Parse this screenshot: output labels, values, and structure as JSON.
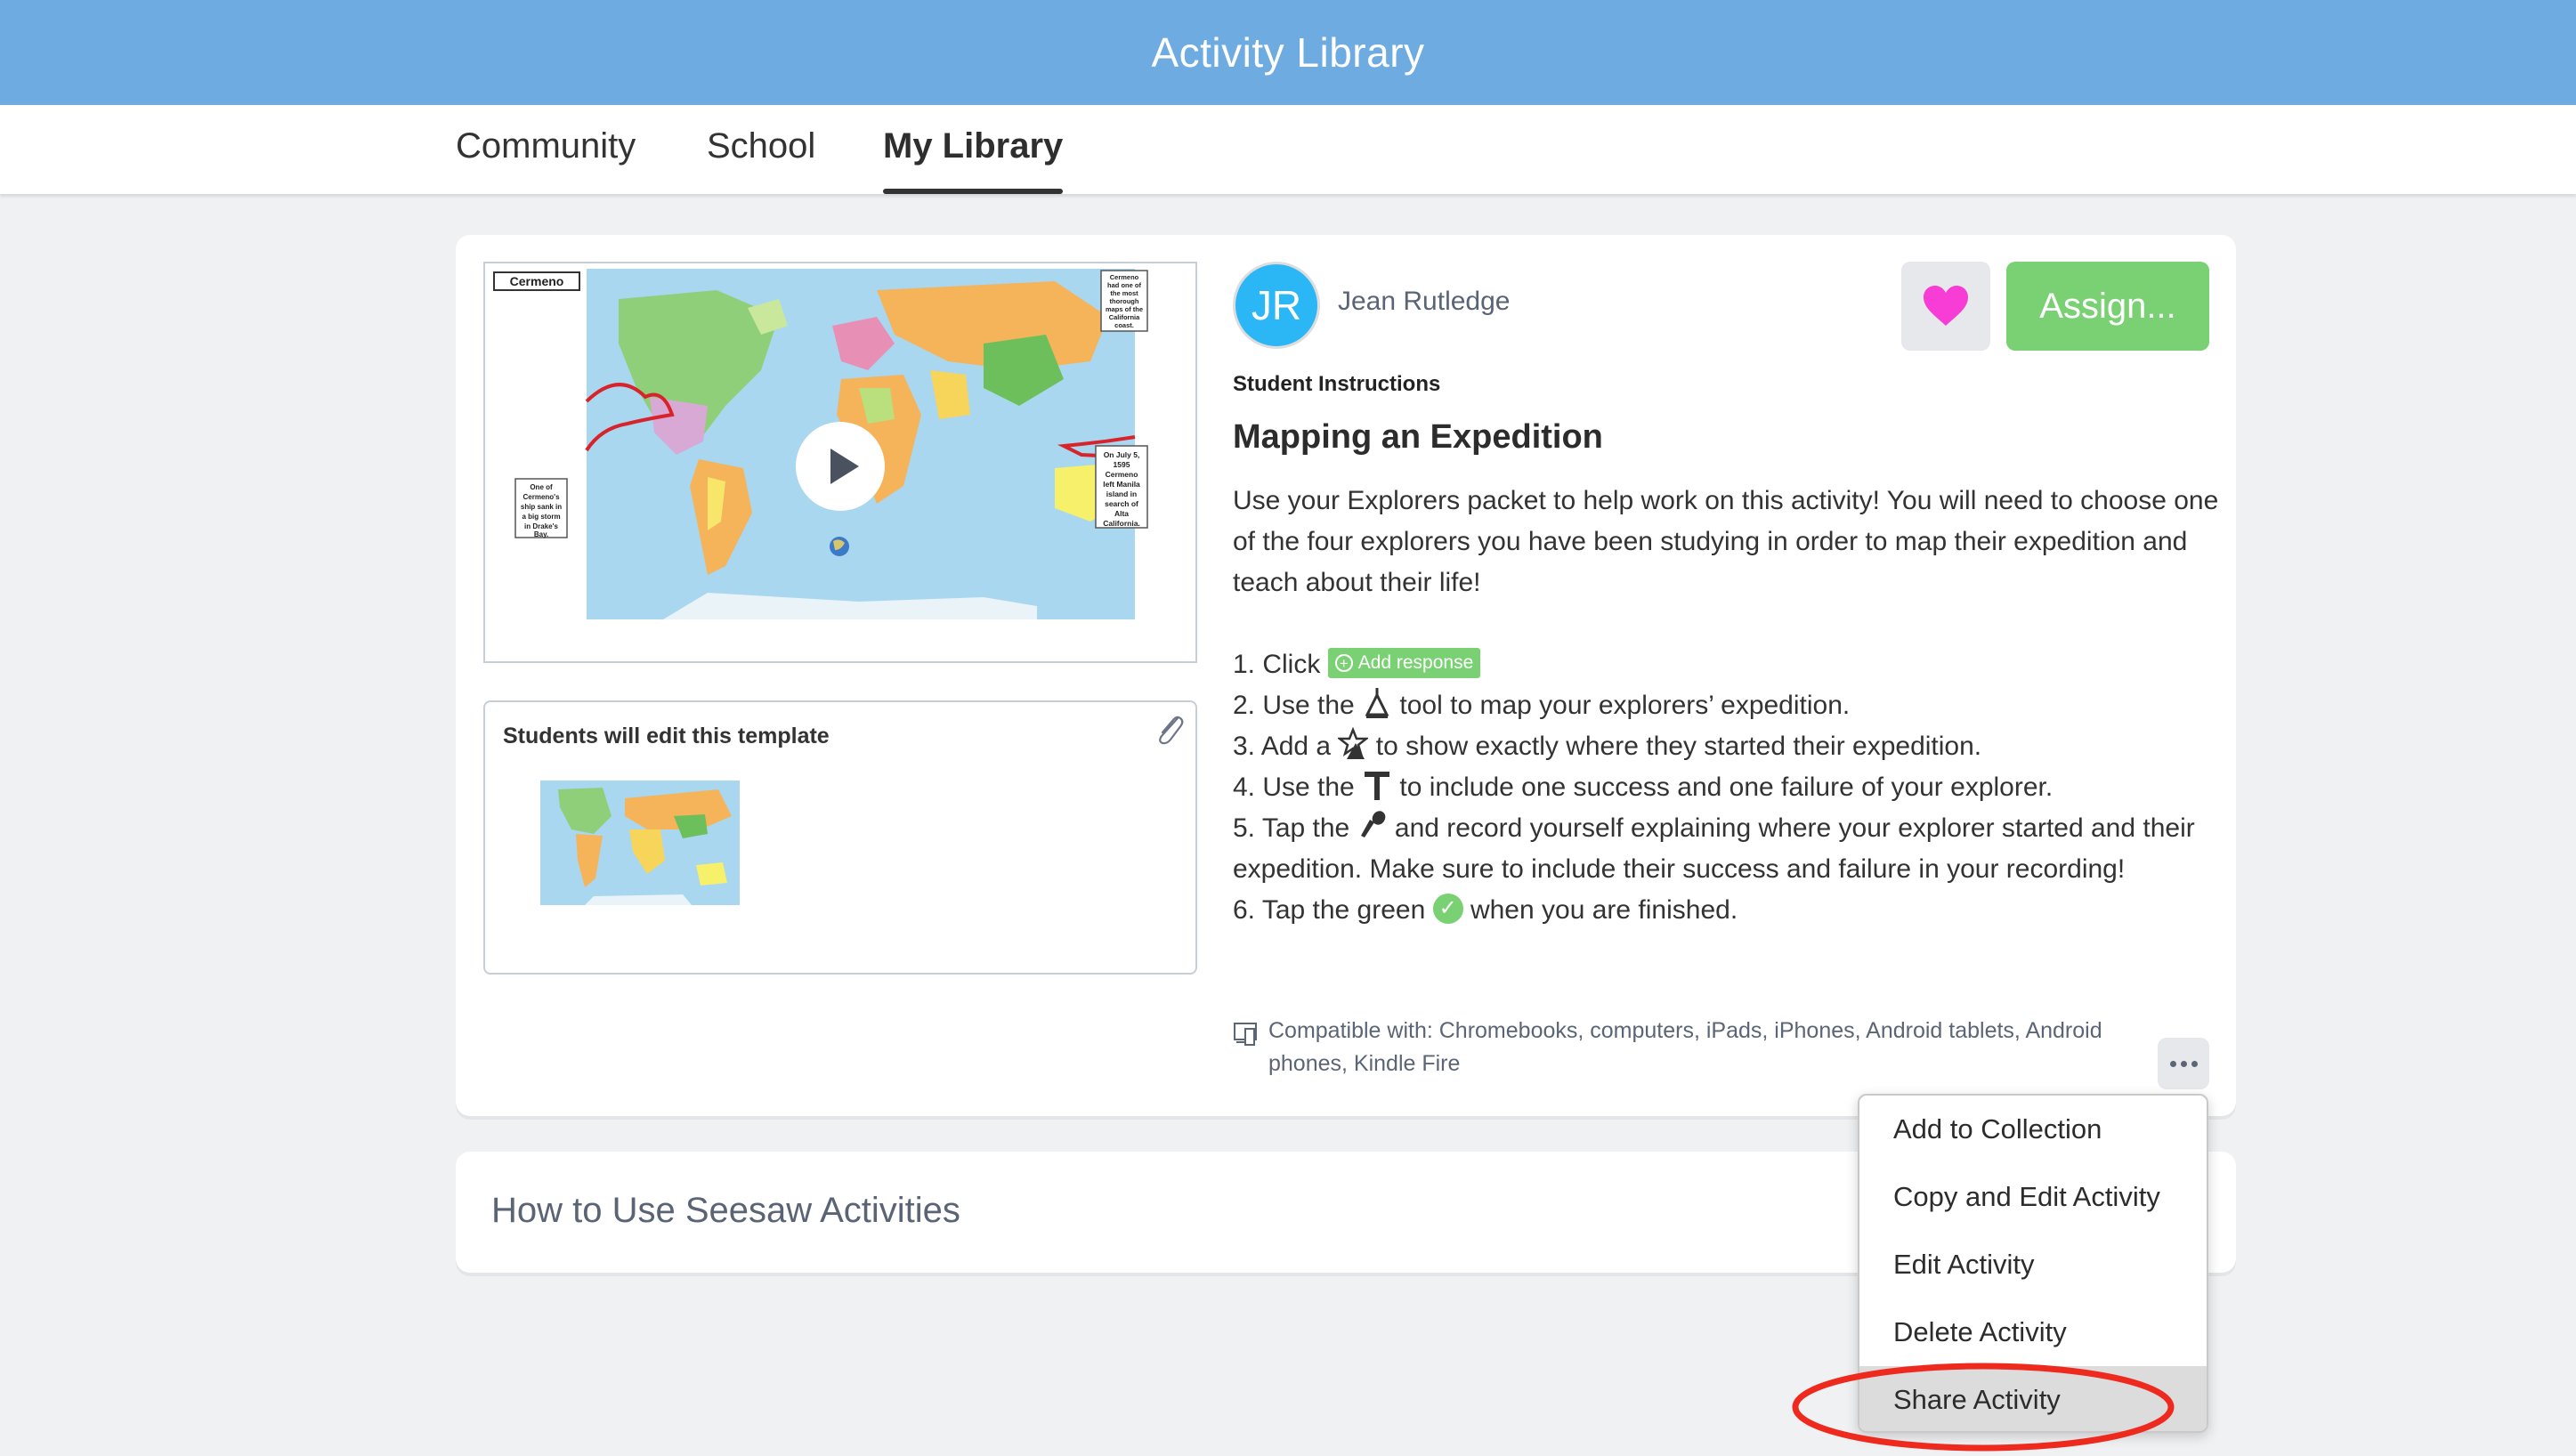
{
  "header": {
    "title": "Activity Library"
  },
  "tabs": [
    {
      "label": "Community",
      "active": false
    },
    {
      "label": "School",
      "active": false
    },
    {
      "label": "My Library",
      "active": true
    }
  ],
  "activity": {
    "preview": {
      "map_title": "Cermeno",
      "callouts": [
        "Cermeno had one of the most thorough maps of the California coast.",
        "One of Cermeno's ship sank in a big storm in Drake's Bay.",
        "On July 5, 1595 Cermeno left Manila island in search of Alta California."
      ],
      "play_icon": "play-icon"
    },
    "template": {
      "label": "Students will edit this template",
      "attach_icon": "paperclip-icon"
    },
    "author": {
      "initials": "JR",
      "name": "Jean Rutledge",
      "avatar_color": "#2bb6f6"
    },
    "favorite_icon": "heart-icon",
    "favorite_color": "#f83dd6",
    "assign_label": "Assign...",
    "assign_color": "#7ad173",
    "instructions_label": "Student Instructions",
    "title": "Mapping an Expedition",
    "description": "Use your Explorers packet to help work on this activity! You will need to choose one of the four explorers you have been studying in order to map their expedition and teach about their life!",
    "steps": [
      {
        "before": "1. Click ",
        "icon": "add-response-button",
        "pill_label": "Add response",
        "after": ""
      },
      {
        "before": "2. Use the ",
        "icon": "drawing-tool-icon",
        "after": " tool to map your explorers’ expedition."
      },
      {
        "before": "3. Add a ",
        "icon": "shapes-icon",
        "after": " to show exactly where they started their expedition."
      },
      {
        "before": "4. Use the ",
        "icon": "text-tool-icon",
        "after": " to include one success and one failure of your explorer."
      },
      {
        "before": "5. Tap the ",
        "icon": "microphone-icon",
        "after": " and record yourself explaining where your explorer started and their expedition. Make sure to include their success and failure in your record­ing!"
      },
      {
        "before": "6. Tap the green ",
        "icon": "check-icon",
        "after": " when you are finished."
      }
    ],
    "compatibility": "Compatible with: Chromebooks, computers, iPads, iPhones, Android tablets, Android phones, Kindle Fire",
    "more_icon": "more-options-icon"
  },
  "second_card": {
    "title": "How to Use Seesaw Activities"
  },
  "menu": {
    "items": [
      {
        "label": "Add to Collection",
        "highlighted": false
      },
      {
        "label": "Copy and Edit Activity",
        "highlighted": false
      },
      {
        "label": "Edit Activity",
        "highlighted": false
      },
      {
        "label": "Delete Activity",
        "highlighted": false
      },
      {
        "label": "Share Activity",
        "highlighted": true
      }
    ]
  },
  "annotation": {
    "color": "#ee2a1e",
    "target": "Share Activity"
  },
  "colors": {
    "header": "#6eabe1",
    "background": "#f0f1f3",
    "accent_green": "#7ad173"
  }
}
